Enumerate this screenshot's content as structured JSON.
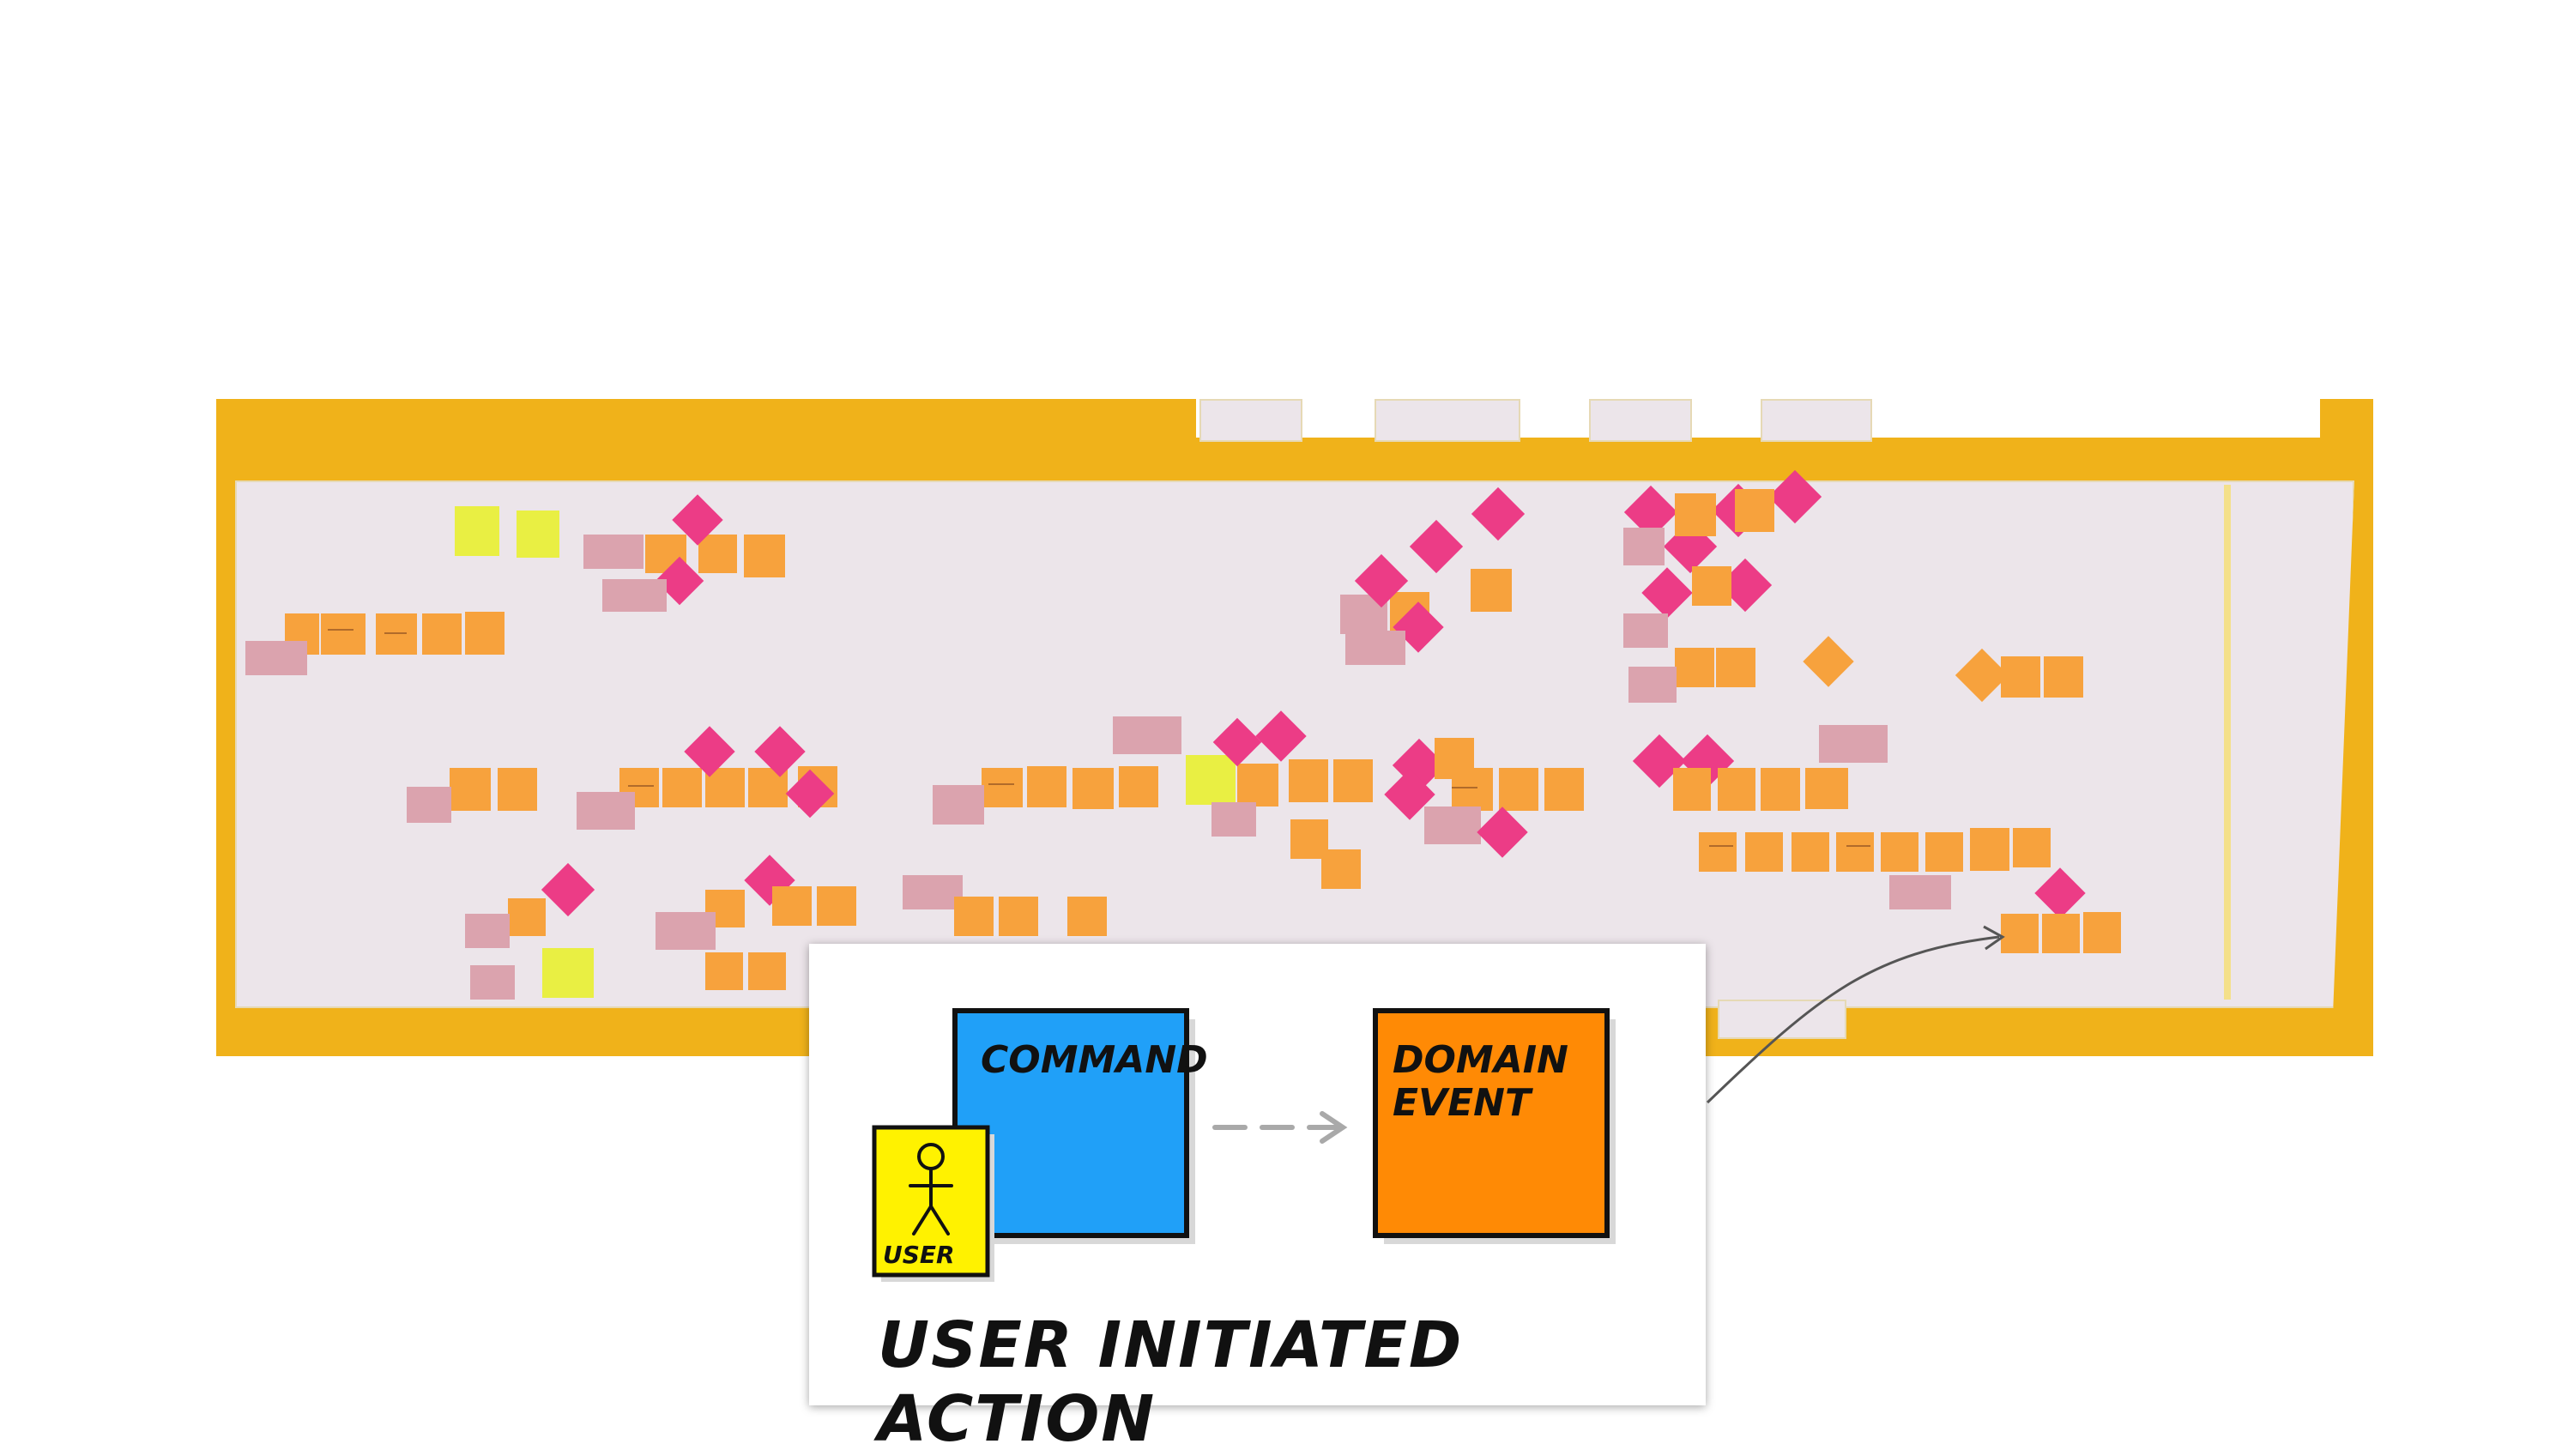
{
  "legend": {
    "command_label": "COMMAND",
    "domain_event_label": "DOMAIN EVENT",
    "user_label": "USER",
    "caption": "USER INITIATED ACTION"
  },
  "colors": {
    "board_frame": "#f0b21a",
    "paper": "#ece5ea",
    "command": "#20a0f8",
    "domain_event": "#ff8a05",
    "user": "#fff200",
    "hotspot": "#ec3c86",
    "event_note": "#f7a23d",
    "policy_note": "#dba3ae"
  }
}
